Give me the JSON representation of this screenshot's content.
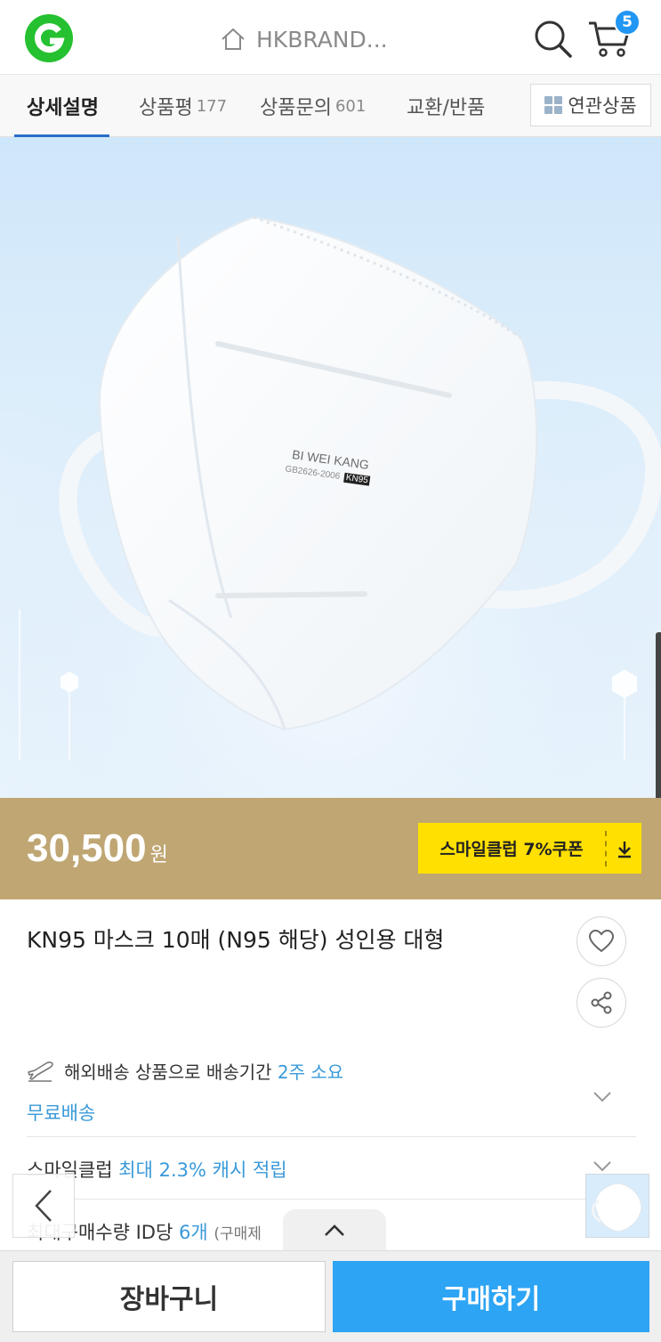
{
  "header": {
    "logo_letter": "G",
    "store_name": "HKBRAND...",
    "cart_count": "5",
    "brand_color": "#25c130"
  },
  "tabs": [
    {
      "label": "상세설명",
      "count": ""
    },
    {
      "label": "상품평",
      "count": "177"
    },
    {
      "label": "상품문의",
      "count": "601"
    },
    {
      "label": "교환/반품",
      "count": ""
    }
  ],
  "related_label": "연관상품",
  "hero": {
    "print_line1": "BI WEI KANG",
    "print_line2": "GB2626-2006",
    "print_tag": "KN95"
  },
  "price": {
    "amount": "30,500",
    "unit": "원",
    "coupon": "스마일클럽 7%쿠폰"
  },
  "product": {
    "title": "KN95 마스크 10매 (N95 해당) 성인용 대형"
  },
  "shipping": {
    "text": "해외배송 상품으로 배송기간",
    "highlight": "2주 소요",
    "free": "무료배송"
  },
  "smile_club": {
    "label": "스마일클럽",
    "highlight": "최대 2.3% 캐시 적립"
  },
  "max_purchase": {
    "label": "최대구매수량 ID당",
    "highlight": "6개",
    "note": "(구매제"
  },
  "actions": {
    "add_to_cart": "장바구니",
    "buy_now": "구매하기"
  },
  "colors": {
    "price_bar": "#bfa673",
    "coupon": "#ffe001",
    "accent_blue": "#2da4f4",
    "link_blue": "#3a9ad9"
  }
}
